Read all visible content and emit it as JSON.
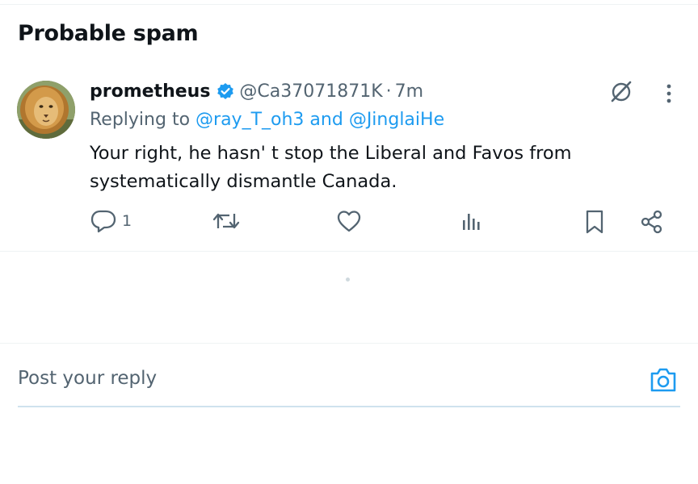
{
  "section": {
    "title": "Probable spam"
  },
  "tweet": {
    "display_name": "prometheus",
    "handle": "@Ca37071871K",
    "separator": "·",
    "time": "7m",
    "replying_prefix": "Replying to",
    "mention_1": "@ray_T_oh3",
    "mention_joiner": "and",
    "mention_2": "@JinglaiHe",
    "text": "Your right, he hasn' t stop the Liberal and Favos from systematically dismantle Canada.",
    "verified": true,
    "reply_count": "1"
  },
  "actions": {
    "icons": [
      "reply-icon",
      "retweet-icon",
      "like-icon",
      "views-icon",
      "bookmark-icon",
      "share-icon"
    ]
  },
  "reply_box": {
    "placeholder": "Post your reply"
  },
  "colors": {
    "accent": "#1d9bf0",
    "muted": "#536471",
    "text": "#0f1419"
  }
}
